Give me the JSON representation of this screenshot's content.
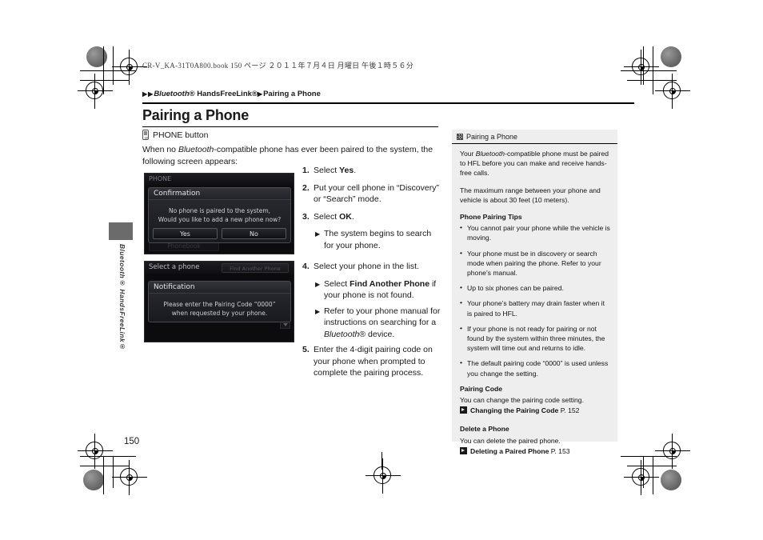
{
  "file_header": "CR-V_KA-31T0A800.book    150 ページ    ２０１１年７月４日    月曜日    午後１時５６分",
  "breadcrumb": {
    "marker1": "▶",
    "marker2": "▶",
    "item1_italic": "Bluetooth",
    "item1_rest": "® HandsFreeLink®",
    "marker3": "▶",
    "item2": "Pairing a Phone"
  },
  "page_title": "Pairing a Phone",
  "phone_button": {
    "icon": "phone-button-icon",
    "label": "PHONE button"
  },
  "intro": {
    "part1": "When no ",
    "italic": "Bluetooth",
    "part2": "-compatible phone has ever been paired to the system, the following screen appears:"
  },
  "lcd_screens": [
    {
      "name": "confirmation-screen",
      "topbar": "PHONE",
      "dialog_title": "Confirmation",
      "body_line1": "No phone is paired to the system,",
      "body_line2": "Would you like to add a new phone now?",
      "buttons": [
        "Yes",
        "No"
      ],
      "background_button": "Phonebook"
    },
    {
      "name": "notification-screen",
      "topbar": "Select a phone",
      "tab_label": "Find Another Phone",
      "dialog_title": "Notification",
      "body_line1": "Please enter the Pairing Code “0000”",
      "body_line2": "when requested by your phone."
    }
  ],
  "steps": [
    {
      "num": "1.",
      "text_pre": "Select ",
      "bold": "Yes",
      "text_post": ".",
      "subs": []
    },
    {
      "num": "2.",
      "text_pre": "Put your cell phone in “Discovery” or “Search” mode.",
      "bold": "",
      "text_post": "",
      "subs": []
    },
    {
      "num": "3.",
      "text_pre": "Select ",
      "bold": "OK",
      "text_post": ".",
      "subs": [
        {
          "marker": "▶",
          "text": "The system begins to search for your phone."
        }
      ]
    },
    {
      "num": "4.",
      "text_pre": "Select your phone in the list.",
      "bold": "",
      "text_post": "",
      "subs": [
        {
          "marker": "▶",
          "pre": "Select ",
          "bold": "Find Another Phone",
          "post": " if your phone is not found."
        },
        {
          "marker": "▶",
          "pre": "Refer to your phone manual for instructions on searching for a ",
          "italic": "Bluetooth",
          "post": "® device."
        }
      ]
    },
    {
      "num": "5.",
      "text_pre": "Enter the 4-digit pairing code on your phone when prompted to complete the pairing process.",
      "bold": "",
      "text_post": "",
      "subs": []
    }
  ],
  "panel": {
    "header_icon": "note-icon",
    "header": "Pairing a Phone",
    "para1_pre": "Your ",
    "para1_italic": "Bluetooth",
    "para1_post": "-compatible phone must be paired to HFL before you can make and receive hands-free calls.",
    "para2": "The maximum range between your phone and vehicle is about 30 feet (10 meters).",
    "tips_heading": "Phone Pairing Tips",
    "tips": [
      "You cannot pair your phone while the vehicle is moving.",
      "Your phone must be in discovery or search mode when pairing the phone. Refer to your phone’s manual.",
      "Up to six phones can be paired.",
      "Your phone’s battery may drain faster when it is paired to HFL.",
      "If your phone is not ready for pairing or not found by the system within three minutes, the system will time out and returns to idle.",
      "The default pairing code “0000” is used unless you change the setting."
    ],
    "pairing_code_heading": "Pairing Code",
    "pairing_code_text": "You can change the pairing code setting.",
    "pairing_code_xref": "Changing the Pairing Code",
    "pairing_code_page": "P. 152",
    "delete_heading": "Delete a Phone",
    "delete_text": "You can delete the paired phone.",
    "delete_xref": "Deleting a Paired Phone",
    "delete_page": "P. 153"
  },
  "side_tab_label": "Bluetooth® HandsFreeLink®",
  "page_number": "150"
}
